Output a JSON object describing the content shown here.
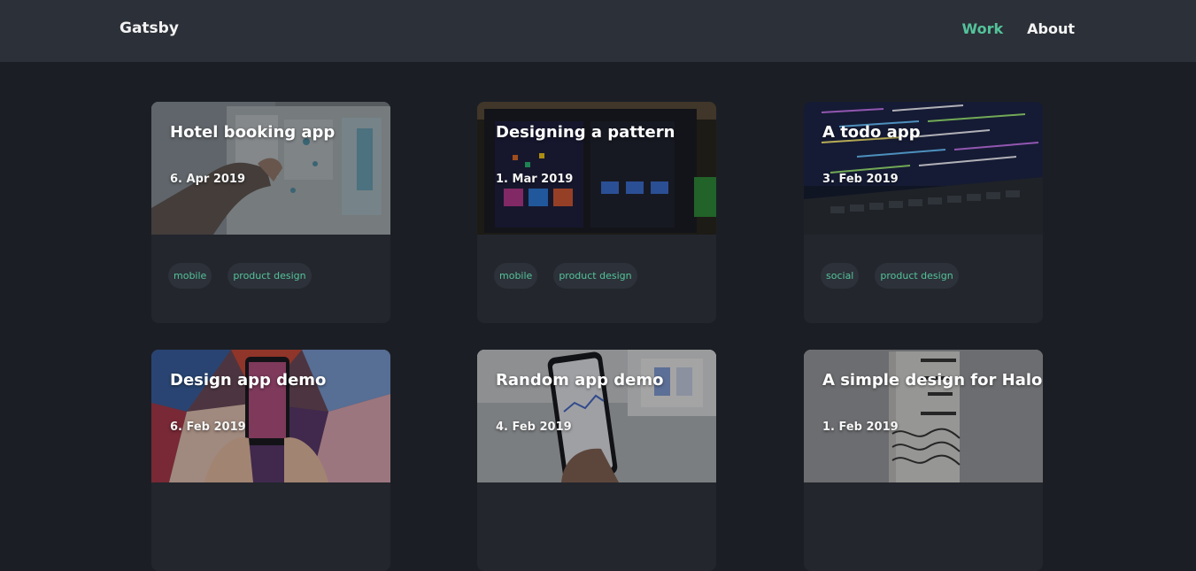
{
  "header": {
    "brand": "Gatsby",
    "nav": [
      {
        "label": "Work",
        "active": true
      },
      {
        "label": "About",
        "active": false
      }
    ]
  },
  "colors": {
    "accent": "#53c39a",
    "background": "#1b1f25",
    "header": "#2c3038",
    "card": "#23262d"
  },
  "projects": [
    {
      "title": "Hotel booking app",
      "date": "6. Apr 2019",
      "tags": [
        "mobile",
        "product design"
      ],
      "image": "whiteboard-photo"
    },
    {
      "title": "Designing a pattern",
      "date": "1. Mar 2019",
      "tags": [
        "mobile",
        "product design"
      ],
      "image": "monitor-design-photo"
    },
    {
      "title": "A todo app",
      "date": "3. Feb 2019",
      "tags": [
        "social",
        "product design"
      ],
      "image": "code-laptop-photo"
    },
    {
      "title": "Design app demo",
      "date": "6. Feb 2019",
      "tags": [],
      "image": "phone-art-photo"
    },
    {
      "title": "Random app demo",
      "date": "4. Feb 2019",
      "tags": [],
      "image": "phone-chart-photo"
    },
    {
      "title": "A simple design for Halo",
      "date": "1. Feb 2019",
      "tags": [],
      "image": "boxed-water-photo"
    }
  ]
}
